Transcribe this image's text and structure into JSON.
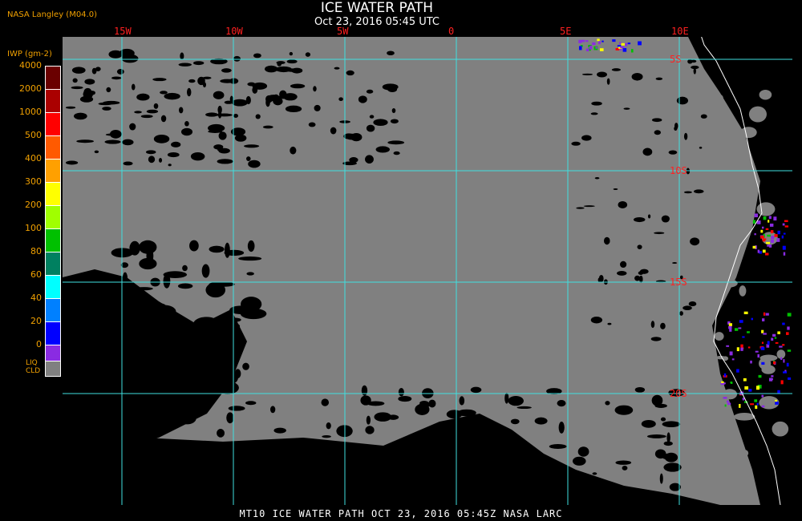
{
  "title": "ICE WATER PATH",
  "subtitle": "Oct 23, 2016 05:45 UTC",
  "producer": "NASA Langley (M04.0)",
  "legend": {
    "unit": "IWP (gm-2)",
    "levels": [
      {
        "label": "4000",
        "color": "#6a0000"
      },
      {
        "label": "2000",
        "color": "#aa0000"
      },
      {
        "label": "1000",
        "color": "#ff0000"
      },
      {
        "label": "500",
        "color": "#ff5a00"
      },
      {
        "label": "400",
        "color": "#ffa000"
      },
      {
        "label": "300",
        "color": "#ffff00"
      },
      {
        "label": "200",
        "color": "#a0ff00"
      },
      {
        "label": "100",
        "color": "#00c000"
      },
      {
        "label": "80",
        "color": "#008060"
      },
      {
        "label": "60",
        "color": "#00ffff"
      },
      {
        "label": "40",
        "color": "#0080ff"
      },
      {
        "label": "20",
        "color": "#0000ff"
      },
      {
        "label": "0",
        "color": "#8a2be2"
      }
    ],
    "liquid_cloud_label": "LIQ\nCLD",
    "liquid_cloud_color": "#808080"
  },
  "map": {
    "longitudes": [
      "15W",
      "10W",
      "5W",
      "0",
      "5E",
      "10E"
    ],
    "latitudes": [
      "5S",
      "10S",
      "15S",
      "20S"
    ],
    "grid_color": "#40e0e0",
    "label_color": "#ff2020",
    "cloud_color": "#808080",
    "clear_color": "#000000",
    "coast_color": "#ffffff"
  },
  "footer": "MT10  ICE WATER PATH   OCT 23, 2016 05:45Z   NASA LARC"
}
